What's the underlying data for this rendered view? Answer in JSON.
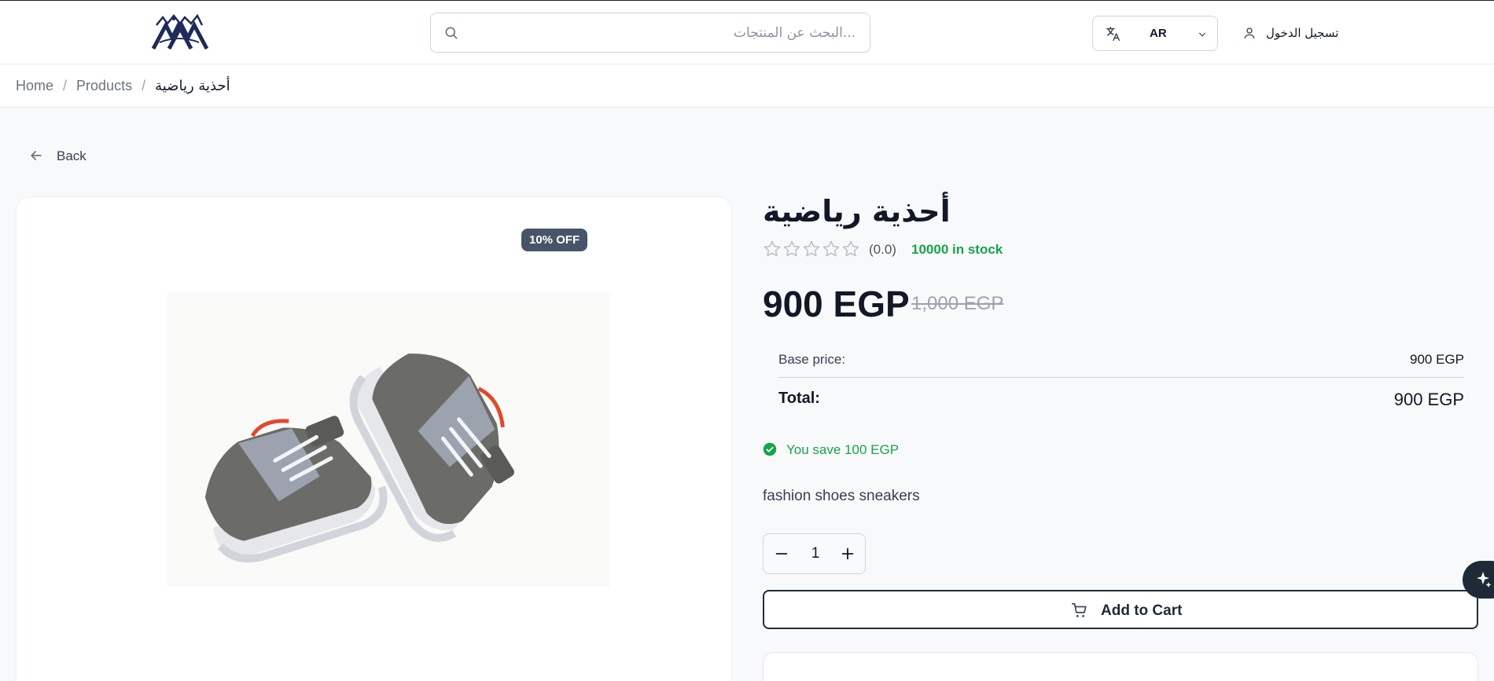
{
  "header": {
    "search": {
      "placeholder": "...البحث عن المنتجات"
    },
    "language": {
      "code": "AR"
    },
    "login_label": "تسجيل الدخول"
  },
  "breadcrumb": {
    "home": "Home",
    "products": "Products",
    "current": "أحذية رياضية"
  },
  "back_label": "Back",
  "product": {
    "discount_badge": "10% OFF",
    "title": "أحذية رياضية",
    "rating_value": 0,
    "rating_max": 5,
    "rating_text": "(0.0)",
    "stock_text": "10000 in stock",
    "price": "900 EGP",
    "old_price": "1,000 EGP",
    "base_price_label": "Base price:",
    "base_price_value": "900 EGP",
    "total_label": "Total:",
    "total_value": "900 EGP",
    "savings_text": "You save 100 EGP",
    "description": "fashion shoes sneakers",
    "quantity": "1",
    "add_to_cart_label": "Add to Cart"
  },
  "colors": {
    "accent_dark": "#1f2d3d",
    "stock_green": "#16a34a",
    "badge_bg": "#475569"
  },
  "icons": [
    "logo-icon",
    "search-icon",
    "translate-icon",
    "chevron-down-icon",
    "user-icon",
    "arrow-left-icon",
    "star-icon",
    "check-circle-icon",
    "minus-icon",
    "plus-icon",
    "cart-icon",
    "sparkle-icon"
  ]
}
